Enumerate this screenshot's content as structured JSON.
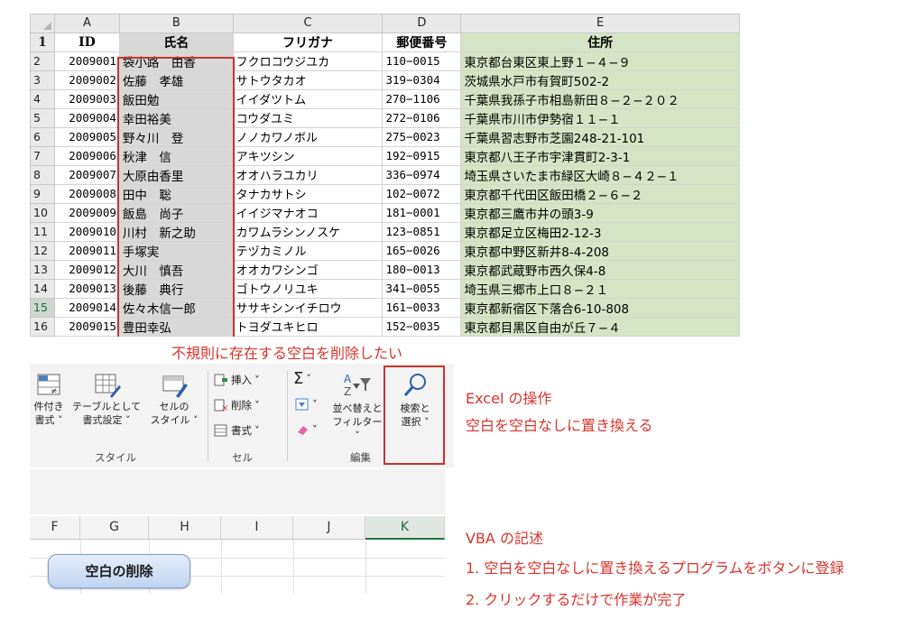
{
  "sheet": {
    "col_headers": [
      "A",
      "B",
      "C",
      "D",
      "E"
    ],
    "header_row": {
      "row": "1",
      "id": "ID",
      "name": "氏名",
      "kana": "フリガナ",
      "zip": "郵便番号",
      "address": "住所"
    },
    "rows": [
      {
        "row": "2",
        "id": "2009001",
        "name": "袋小路　由香",
        "kana": "フクロコウジユカ",
        "zip": "110−0015",
        "address": "東京都台東区東上野１−４−９"
      },
      {
        "row": "3",
        "id": "2009002",
        "name": "佐藤　孝雄",
        "kana": "サトウタカオ",
        "zip": "319−0304",
        "address": "茨城県水戸市有賀町502-2"
      },
      {
        "row": "4",
        "id": "2009003",
        "name": "飯田勉",
        "kana": "イイダツトム",
        "zip": "270−1106",
        "address": "千葉県我孫子市相島新田８−２−２０２"
      },
      {
        "row": "5",
        "id": "2009004",
        "name": "幸田裕美",
        "kana": "コウダユミ",
        "zip": "272−0106",
        "address": "千葉県市川市伊勢宿１１−１"
      },
      {
        "row": "6",
        "id": "2009005",
        "name": "野々川　登",
        "kana": "ノノカワノボル",
        "zip": "275−0023",
        "address": "千葉県習志野市芝園248-21-101"
      },
      {
        "row": "7",
        "id": "2009006",
        "name": "秋津　信",
        "kana": "アキツシン",
        "zip": "192−0915",
        "address": "東京都八王子市宇津貫町2-3-1"
      },
      {
        "row": "8",
        "id": "2009007",
        "name": "大原由香里",
        "kana": "オオハラユカリ",
        "zip": "336−0974",
        "address": "埼玉県さいたま市緑区大崎８−４２−１"
      },
      {
        "row": "9",
        "id": "2009008",
        "name": "田中　聡",
        "kana": "タナカサトシ",
        "zip": "102−0072",
        "address": "東京都千代田区飯田橋２−６−２"
      },
      {
        "row": "10",
        "id": "2009009",
        "name": "飯島　尚子",
        "kana": "イイジマナオコ",
        "zip": "181−0001",
        "address": "東京都三鷹市井の頭3-9"
      },
      {
        "row": "11",
        "id": "2009010",
        "name": "川村　新之助",
        "kana": "カワムラシンノスケ",
        "zip": "123−0851",
        "address": "東京都足立区梅田2-12-3"
      },
      {
        "row": "12",
        "id": "2009011",
        "name": "手塚実",
        "kana": "テヅカミノル",
        "zip": "165−0026",
        "address": "東京都中野区新井8-4-208"
      },
      {
        "row": "13",
        "id": "2009012",
        "name": "大川　慎吾",
        "kana": "オオカワシンゴ",
        "zip": "180−0013",
        "address": "東京都武蔵野市西久保4-8"
      },
      {
        "row": "14",
        "id": "2009013",
        "name": "後藤　典行",
        "kana": "ゴトウノリユキ",
        "zip": "341−0055",
        "address": "埼玉県三郷市上口８−２１"
      },
      {
        "row": "15",
        "id": "2009014",
        "name": "佐々木信一郎",
        "kana": "ササキシンイチロウ",
        "zip": "161−0033",
        "address": "東京都新宿区下落合6-10-808"
      },
      {
        "row": "16",
        "id": "2009015",
        "name": "豊田幸弘",
        "kana": "トヨダユキヒロ",
        "zip": "152−0035",
        "address": "東京都目黒区自由が丘７−４"
      }
    ]
  },
  "caption_top": "不規則に存在する空白を削除したい",
  "ribbon": {
    "conditional_label_1": "件付き",
    "conditional_label_2": "書式",
    "table_label_1": "テーブルとして",
    "table_label_2": "書式設定",
    "cellstyle_label_1": "セルの",
    "cellstyle_label_2": "スタイル",
    "group_style": "スタイル",
    "insert": "挿入",
    "delete": "削除",
    "format": "書式",
    "group_cell": "セル",
    "sort_label_1": "並べ替えと",
    "sort_label_2": "フィルター",
    "find_label_1": "検索と",
    "find_label_2": "選択",
    "group_edit": "編集"
  },
  "lower_cols": [
    "F",
    "G",
    "H",
    "I",
    "J",
    "K"
  ],
  "macro_button": "空白の削除",
  "notes": {
    "excel_title": "Excel の操作",
    "excel_desc": "空白を空白なしに置き換える",
    "vba_title": "VBA の記述",
    "vba_step1": "1. 空白を空白なしに置き換えるプログラムをボタンに登録",
    "vba_step2": "2. クリックするだけで作業が完了"
  },
  "colors": {
    "accent_red": "#d9342b",
    "name_col_bg": "#d8d8d8",
    "address_col_bg": "#d5e4c4",
    "excel_green": "#217346"
  }
}
